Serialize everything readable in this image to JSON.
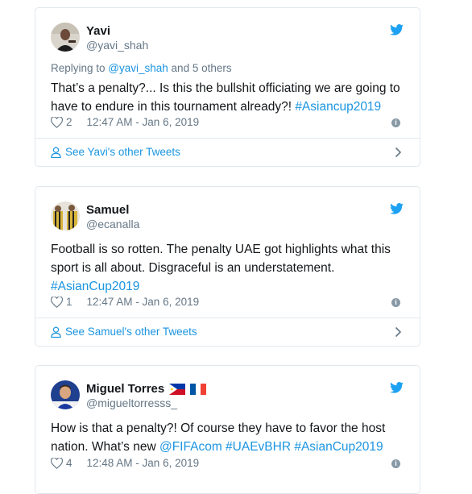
{
  "colors": {
    "link": "#1b95e0",
    "muted": "#657786",
    "border": "#e1e8ed",
    "twitter_blue": "#1da1f2"
  },
  "tweets": [
    {
      "name": "Yavi",
      "handle": "@yavi_shah",
      "replying_prefix": "Replying to ",
      "replying_handle": "@yavi_shah",
      "replying_suffix": " and 5 others",
      "text_before": "That’s a penalty?... Is this the bullshit officiating we are going to have to endure in this tournament already?! ",
      "hashtag": "#Asiancup2019",
      "likes": "2",
      "time": "12:47 AM - Jan 6, 2019",
      "other_tweets": "See Yavi's other Tweets"
    },
    {
      "name": "Samuel",
      "handle": "@ecanalla",
      "text_before": "Football is so rotten. The penalty UAE got highlights what this sport is all about. Disgraceful is an understatement. ",
      "hashtag": "#AsianCup2019",
      "likes": "1",
      "time": "12:47 AM - Jan 6, 2019",
      "other_tweets": "See Samuel's other Tweets"
    },
    {
      "name": "Miguel Torres",
      "handle": "@migueltorresss_",
      "text_before": "How is that a penalty?! Of course they have to favor the host nation. What’s new ",
      "mention": "@FIFAcom",
      "hashtag_1": "#UAEvBHR",
      "hashtag_2": "#AsianCup2019",
      "likes": "4",
      "time": "12:48 AM - Jan 6, 2019",
      "flags": [
        "philippines-flag",
        "france-flag"
      ]
    }
  ]
}
